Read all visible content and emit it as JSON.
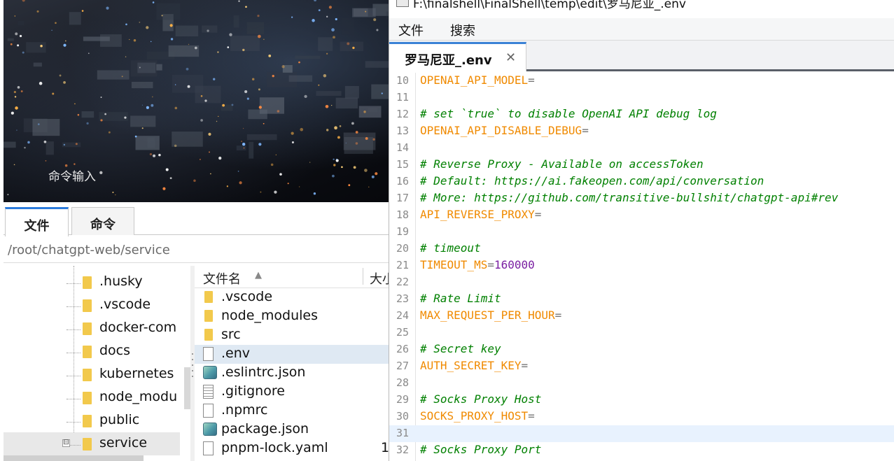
{
  "left_panel": {
    "terminal_label": "命令输入",
    "tabs": [
      {
        "label": "文件",
        "active": true
      },
      {
        "label": "命令",
        "active": false
      }
    ],
    "path": "/root/chatgpt-web/service",
    "tree_items": [
      {
        "label": ".husky"
      },
      {
        "label": ".vscode"
      },
      {
        "label": "docker-com"
      },
      {
        "label": "docs"
      },
      {
        "label": "kubernetes"
      },
      {
        "label": "node_modu"
      },
      {
        "label": "public"
      },
      {
        "label": "service",
        "selected": true,
        "collapse_icon": "⊟"
      }
    ],
    "file_list": {
      "columns": {
        "name": "文件名",
        "size": "大小"
      },
      "sort_icon": "▲",
      "rows": [
        {
          "name": ".vscode",
          "icon": "folder-icon"
        },
        {
          "name": "node_modules",
          "icon": "folder-icon"
        },
        {
          "name": "src",
          "icon": "folder-icon"
        },
        {
          "name": ".env",
          "icon": "file-icon",
          "selected": true
        },
        {
          "name": ".eslintrc.json",
          "icon": "json-file-icon"
        },
        {
          "name": ".gitignore",
          "icon": "text-file-icon"
        },
        {
          "name": ".npmrc",
          "icon": "file-icon"
        },
        {
          "name": "package.json",
          "icon": "json-file-icon"
        },
        {
          "name": "pnpm-lock.yaml",
          "icon": "file-icon",
          "size": "1"
        }
      ]
    }
  },
  "editor": {
    "title": "F:\\finalshell\\FinalShell\\temp\\edit\\罗马尼亚_.env",
    "menu": [
      "文件",
      "搜索"
    ],
    "tab": {
      "label": "罗马尼亚_.env",
      "close": "✕"
    },
    "current_line": 31,
    "lines": [
      {
        "n": "10",
        "segments": [
          {
            "t": "OPENAI_API_MODEL",
            "k": "key"
          },
          {
            "t": "=",
            "k": "op"
          }
        ]
      },
      {
        "n": "11",
        "segments": []
      },
      {
        "n": "12",
        "segments": [
          {
            "t": "# set `true` to disable OpenAI API debug log",
            "k": "comment"
          }
        ]
      },
      {
        "n": "13",
        "segments": [
          {
            "t": "OPENAI_API_DISABLE_DEBUG",
            "k": "key"
          },
          {
            "t": "=",
            "k": "op"
          }
        ]
      },
      {
        "n": "14",
        "segments": []
      },
      {
        "n": "15",
        "segments": [
          {
            "t": "# Reverse Proxy - Available on accessToken",
            "k": "comment"
          }
        ]
      },
      {
        "n": "16",
        "segments": [
          {
            "t": "# Default: https://ai.fakeopen.com/api/conversation",
            "k": "comment"
          }
        ]
      },
      {
        "n": "17",
        "segments": [
          {
            "t": "# More: https://github.com/transitive-bullshit/chatgpt-api#rev",
            "k": "comment"
          }
        ]
      },
      {
        "n": "18",
        "segments": [
          {
            "t": "API_REVERSE_PROXY",
            "k": "key"
          },
          {
            "t": "=",
            "k": "op"
          }
        ]
      },
      {
        "n": "19",
        "segments": []
      },
      {
        "n": "20",
        "segments": [
          {
            "t": "# timeout",
            "k": "comment"
          }
        ]
      },
      {
        "n": "21",
        "segments": [
          {
            "t": "TIMEOUT_MS",
            "k": "key"
          },
          {
            "t": "=",
            "k": "op"
          },
          {
            "t": "160000",
            "k": "num"
          }
        ]
      },
      {
        "n": "22",
        "segments": []
      },
      {
        "n": "23",
        "segments": [
          {
            "t": "# Rate Limit",
            "k": "comment"
          }
        ]
      },
      {
        "n": "24",
        "segments": [
          {
            "t": "MAX_REQUEST_PER_HOUR",
            "k": "key"
          },
          {
            "t": "=",
            "k": "op"
          }
        ]
      },
      {
        "n": "25",
        "segments": []
      },
      {
        "n": "26",
        "segments": [
          {
            "t": "# Secret key",
            "k": "comment"
          }
        ]
      },
      {
        "n": "27",
        "segments": [
          {
            "t": "AUTH_SECRET_KEY",
            "k": "key"
          },
          {
            "t": "=",
            "k": "op"
          }
        ]
      },
      {
        "n": "28",
        "segments": []
      },
      {
        "n": "29",
        "segments": [
          {
            "t": "# Socks Proxy Host",
            "k": "comment"
          }
        ]
      },
      {
        "n": "30",
        "segments": [
          {
            "t": "SOCKS_PROXY_HOST",
            "k": "key"
          },
          {
            "t": "=",
            "k": "op"
          }
        ]
      },
      {
        "n": "31",
        "segments": []
      },
      {
        "n": "32",
        "segments": [
          {
            "t": "# Socks Proxy Port",
            "k": "comment"
          }
        ]
      }
    ]
  },
  "colors": {
    "comment": "#008000",
    "key": "#f08a00",
    "number": "#7a1fa2",
    "current_line": "#e8f2fe",
    "tab_accent": "#3b82d6",
    "folder": "#f2c94c"
  }
}
